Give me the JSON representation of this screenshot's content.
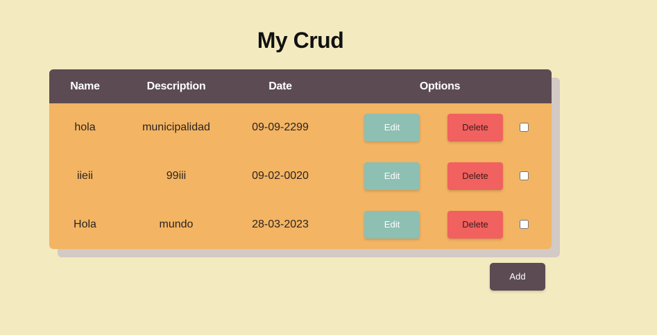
{
  "page": {
    "title": "My Crud"
  },
  "table": {
    "columns": {
      "name": "Name",
      "description": "Description",
      "date": "Date",
      "options": "Options"
    },
    "rows": [
      {
        "name": "hola",
        "description": "municipalidad",
        "date": "09-09-2299",
        "edit_label": "Edit",
        "delete_label": "Delete",
        "checked": false
      },
      {
        "name": "iieii",
        "description": "99iii",
        "date": "09-02-0020",
        "edit_label": "Edit",
        "delete_label": "Delete",
        "checked": false
      },
      {
        "name": "Hola",
        "description": "mundo",
        "date": "28-03-2023",
        "edit_label": "Edit",
        "delete_label": "Delete",
        "checked": false
      }
    ]
  },
  "actions": {
    "add_label": "Add"
  },
  "colors": {
    "background": "#f3eabf",
    "header": "#5c4b52",
    "table_body": "#f3b463",
    "edit_button": "#8dbfb3",
    "delete_button": "#f0615f",
    "add_button": "#5c4b52"
  }
}
